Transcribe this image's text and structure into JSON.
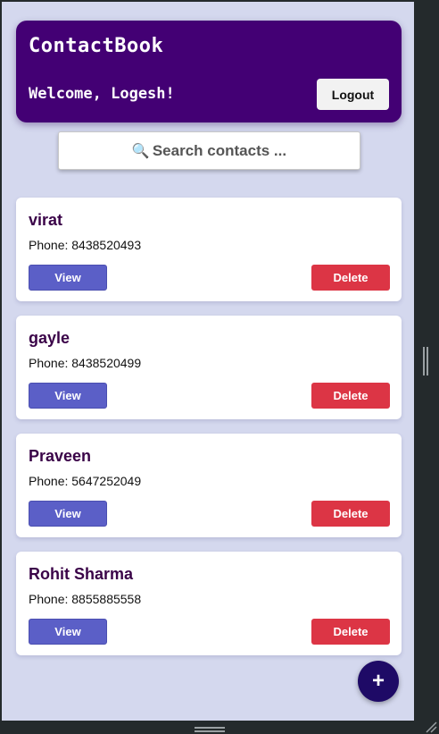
{
  "header": {
    "title": "ContactBook",
    "welcome": "Welcome, Logesh!",
    "logout_label": "Logout"
  },
  "search": {
    "icon": "magnifier-icon",
    "icon_glyph": "🔍",
    "placeholder": "Search contacts  ..."
  },
  "contacts": [
    {
      "name": "virat",
      "phone": "Phone: 8438520493",
      "view_label": "View",
      "delete_label": "Delete"
    },
    {
      "name": "gayle",
      "phone": "Phone: 8438520499",
      "view_label": "View",
      "delete_label": "Delete"
    },
    {
      "name": "Praveen",
      "phone": "Phone: 5647252049",
      "view_label": "View",
      "delete_label": "Delete"
    },
    {
      "name": "Rohit Sharma",
      "phone": "Phone: 8855885558",
      "view_label": "View",
      "delete_label": "Delete"
    }
  ],
  "fab": {
    "label": "+",
    "icon": "plus-icon"
  },
  "colors": {
    "header_bg": "#430074",
    "page_bg": "#d4d8ee",
    "view_button": "#5b5fc7",
    "delete_button": "#dc3545",
    "fab_bg": "#1e0a66",
    "name_text": "#3a0348"
  }
}
